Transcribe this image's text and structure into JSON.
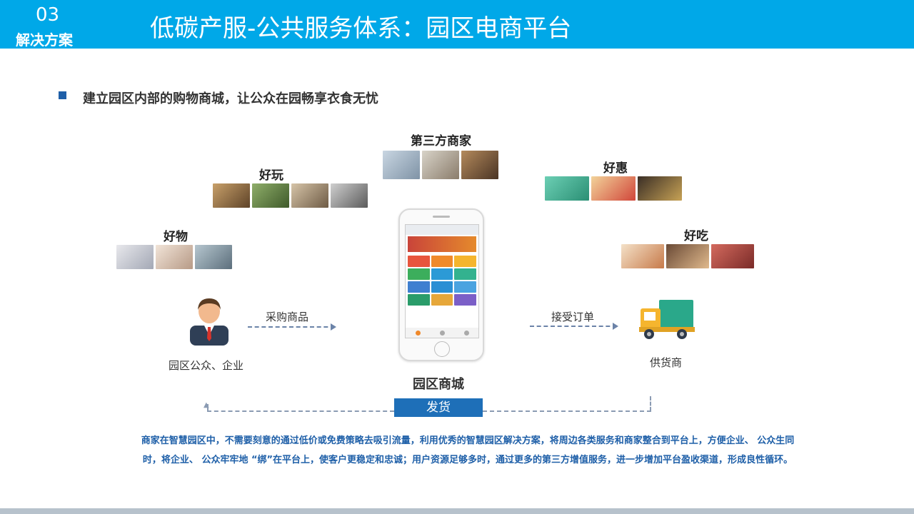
{
  "header": {
    "section_number": "03",
    "section_label": "解决方案",
    "title": "低碳产服-公共服务体系：园区电商平台"
  },
  "bullet": "建立园区内部的购物商城，让公众在园畅享衣食无忧",
  "categories": {
    "third_party": "第三方商家",
    "fun": "好玩",
    "deals": "好惠",
    "goods": "好物",
    "food": "好吃"
  },
  "flow": {
    "buyer_label": "园区公众、企业",
    "purchase_label": "采购商品",
    "mall_label": "园区商城",
    "accept_label": "接受订单",
    "supplier_label": "供货商",
    "ship_label": "发货"
  },
  "description": "商家在智慧园区中，不需要刻意的通过低价或免费策略去吸引流量，利用优秀的智慧园区解决方案，将周边各类服务和商家整合到平台上，方便企业、 公众生同时，将企业、 公众牢牢地 “绑”在平台上，使客户更稳定和忠诚；用户资源足够多时，通过更多的第三方增值服务，进一步增加平台盈收渠道，形成良性循环。",
  "colors": {
    "header_bg": "#00a8e8",
    "accent_blue": "#1e6fb8",
    "description_text": "#1e5fa8"
  }
}
